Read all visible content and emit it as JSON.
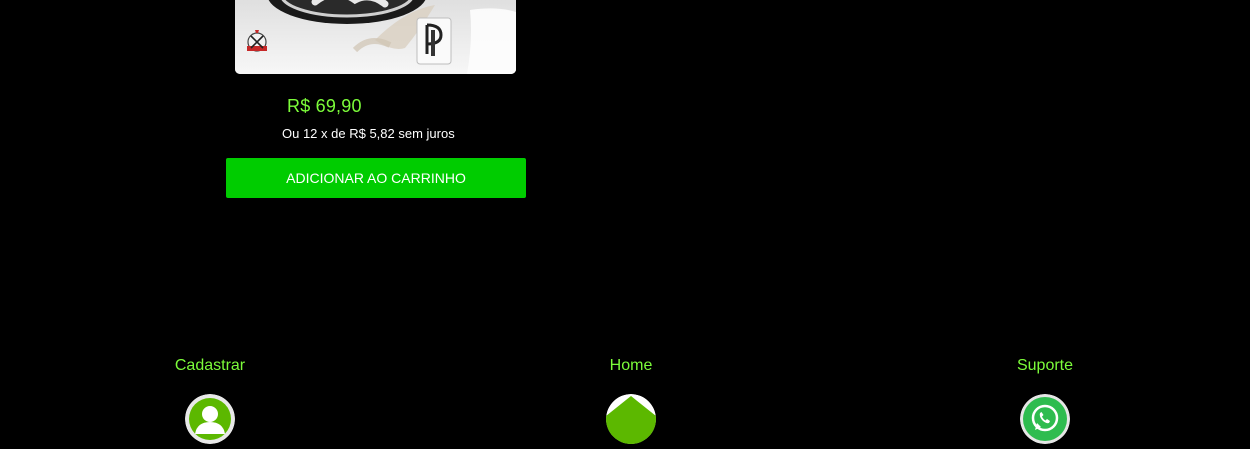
{
  "product": {
    "price": "R$ 69,90",
    "installments": "Ou 12 x de R$ 5,82 sem juros",
    "add_to_cart_label": "ADICIONAR AO CARRINHO"
  },
  "footer": {
    "items": [
      {
        "label": "Cadastrar",
        "icon": "user-avatar-icon"
      },
      {
        "label": "Home",
        "icon": "home-icon"
      },
      {
        "label": "Suporte",
        "icon": "whatsapp-icon"
      }
    ]
  },
  "colors": {
    "background": "#000000",
    "accent_text": "#7cfc3a",
    "button": "#00cc00",
    "icon_green": "#5cb800"
  }
}
